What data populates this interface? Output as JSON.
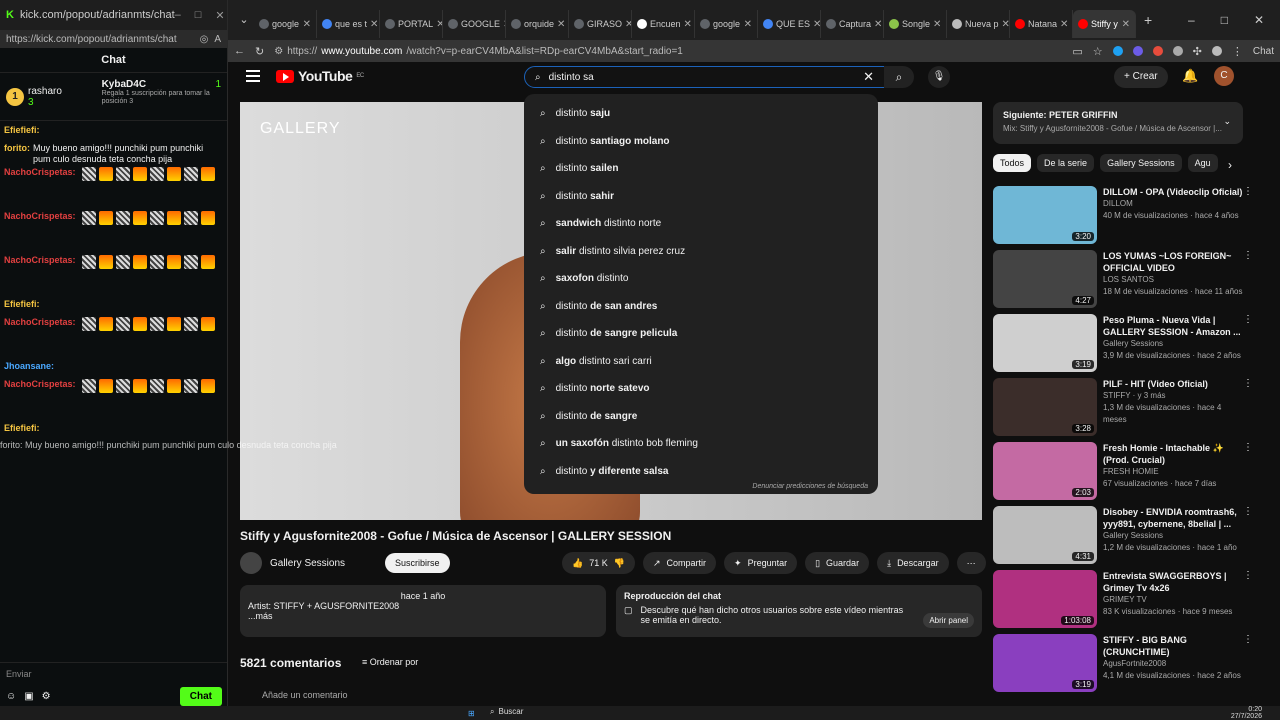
{
  "kick": {
    "window_title": "kick.com/popout/adrianmts/chat",
    "url": "https://kick.com/popout/adrianmts/chat",
    "chat_title": "Chat",
    "pinned": {
      "user1": "rasharo",
      "user1_level": "3",
      "user2": "KybaD4C",
      "user2_count": "1",
      "gift_text": "Regala 1 suscripción para tomar la posición 3"
    },
    "messages": [
      {
        "user": "Efiefiefi:",
        "text": "",
        "color": "yel"
      },
      {
        "user": "forito:",
        "text": "Muy bueno amigo!!! punchiki pum punchiki pum culo desnuda teta concha pija",
        "color": "yel"
      },
      {
        "user": "NachoCrispetas:",
        "text": "",
        "color": "red"
      },
      {
        "user": "NachoCrispetas:",
        "text": "",
        "color": "red"
      },
      {
        "user": "NachoCrispetas:",
        "text": "",
        "color": "red"
      },
      {
        "user": "Efiefiefi:",
        "text": "",
        "color": "yel"
      },
      {
        "user": "NachoCrispetas:",
        "text": "",
        "color": "red"
      },
      {
        "user": "Jhoansane:",
        "text": "",
        "color": "blue"
      },
      {
        "user": "NachoCrispetas:",
        "text": "",
        "color": "red"
      },
      {
        "user": "Efiefiefi:",
        "text": "",
        "color": "yel"
      }
    ],
    "overlay_text": "forito: Muy bueno amigo!!! punchiki pum punchiki pum culo desnuda teta concha pija",
    "send_label": "Enviar",
    "chat_button": "Chat"
  },
  "browser": {
    "tabs": [
      {
        "label": "google",
        "color": "#5f6368"
      },
      {
        "label": "que es t",
        "color": "#4285f4"
      },
      {
        "label": "PORTAL",
        "color": "#5f6368"
      },
      {
        "label": "GOOGLE",
        "color": "#5f6368"
      },
      {
        "label": "orquide",
        "color": "#5f6368"
      },
      {
        "label": "GIRASO",
        "color": "#5f6368"
      },
      {
        "label": "Encuen",
        "color": "#ffffff"
      },
      {
        "label": "google",
        "color": "#5f6368"
      },
      {
        "label": "QUE ES",
        "color": "#4285f4"
      },
      {
        "label": "Captura",
        "color": "#5f6368"
      },
      {
        "label": "Songle",
        "color": "#8bc34a"
      },
      {
        "label": "Nueva p",
        "color": "#bbbbbb"
      },
      {
        "label": "Natana",
        "color": "#ff0000"
      },
      {
        "label": "Stiffy y",
        "color": "#ff0000"
      }
    ],
    "url_prefix": "https://",
    "url_domain": "www.youtube.com",
    "url_path": "/watch?v=p-earCV4MbA&list=RDp-earCV4MbA&start_radio=1",
    "ext_label": "Chat"
  },
  "youtube": {
    "logo_text": "YouTube",
    "logo_sup": "EC",
    "search_value": "distinto sa",
    "create_label": "Crear",
    "avatar_letter": "C",
    "suggestions": [
      {
        "pre": "distinto ",
        "bold": "saju",
        "post": ""
      },
      {
        "pre": "distinto ",
        "bold": "santiago molano",
        "post": ""
      },
      {
        "pre": "distinto ",
        "bold": "sailen",
        "post": ""
      },
      {
        "pre": "distinto ",
        "bold": "sahir",
        "post": ""
      },
      {
        "pre": "",
        "bold": "sandwich ",
        "post": "distinto norte"
      },
      {
        "pre": "",
        "bold": "salir ",
        "post": "distinto silvia perez cruz"
      },
      {
        "pre": "",
        "bold": "saxofon ",
        "post": "distinto"
      },
      {
        "pre": "distinto ",
        "bold": "de san andres",
        "post": ""
      },
      {
        "pre": "distinto ",
        "bold": "de sangre pelicula",
        "post": ""
      },
      {
        "pre": "",
        "bold": "algo ",
        "post": "distinto sari carri"
      },
      {
        "pre": "distinto ",
        "bold": "norte satevo",
        "post": ""
      },
      {
        "pre": "distinto ",
        "bold": "de sangre",
        "post": ""
      },
      {
        "pre": "",
        "bold": "un saxofón ",
        "post": "distinto bob fleming"
      },
      {
        "pre": "distinto ",
        "bold": "y diferente salsa",
        "post": ""
      }
    ],
    "report_predictions": "Denunciar predicciones de búsqueda",
    "video_overlay": "GALLERY",
    "video_title": "Stiffy y Agusfornite2008 - Gofue / Música de Ascensor | GALLERY SESSION",
    "channel": "Gallery Sessions",
    "subscribe": "Suscribirse",
    "likes": "71 K",
    "share": "Compartir",
    "ask": "Preguntar",
    "save": "Guardar",
    "download": "Descargar",
    "desc_line1": "hace 1 año",
    "desc_line2": "Artist: STIFFY + AGUSFORNITE2008",
    "desc_more": "...más",
    "chat_replay_title": "Reproducción del chat",
    "chat_replay_text": "Descubre qué han dicho otros usuarios sobre este vídeo mientras se emitía en directo.",
    "chat_replay_btn": "Abrir panel",
    "comments_count": "5821 comentarios",
    "sort_by": "Ordenar por",
    "add_comment": "Añade un comentario",
    "next_label": "Siguiente: PETER GRIFFIN",
    "next_sub": "Mix: Stiffy y Agusfornite2008 - Gofue / Música de Ascensor |...",
    "chips": [
      "Todos",
      "De la serie",
      "Gallery Sessions",
      "Agu"
    ],
    "recommendations": [
      {
        "title": "DILLOM - OPA (Videoclip Oficial)",
        "channel": "DILLOM",
        "stats": "40 M de visualizaciones · hace 4 años",
        "duration": "3:20",
        "color": "#6fb7d6"
      },
      {
        "title": "LOS YUMAS ~LOS FOREIGN~ OFFICIAL VIDEO",
        "channel": "LOS SANTOS",
        "stats": "18 M de visualizaciones · hace 11 años",
        "duration": "4:27",
        "color": "#444444"
      },
      {
        "title": "Peso Pluma - Nueva Vida | GALLERY SESSION - Amazon ...",
        "channel": "Gallery Sessions",
        "stats": "3,9 M de visualizaciones · hace 2 años",
        "duration": "3:19",
        "color": "#cfcfcf"
      },
      {
        "title": "PILF - HIT (Video Oficial)",
        "channel": "STIFFY · y 3 más",
        "stats": "1,3 M de visualizaciones · hace 4 meses",
        "duration": "3:28",
        "color": "#3b2d2a"
      },
      {
        "title": "Fresh Homie - Intachable ✨ (Prod. Crucial)",
        "channel": "FRESH HOMIE",
        "stats": "67 visualizaciones · hace 7 días",
        "duration": "2:03",
        "color": "#c46aa3"
      },
      {
        "title": "Disobey - ENVIDIA roomtrash6, yyy891, cybernene, 8belial | ...",
        "channel": "Gallery Sessions",
        "stats": "1,2 M de visualizaciones · hace 1 año",
        "duration": "4:31",
        "color": "#bdbdbd"
      },
      {
        "title": "Entrevista SWAGGERBOYS | Grimey Tv 4x26",
        "channel": "GRIMEY TV",
        "stats": "83 K visualizaciones · hace 9 meses",
        "duration": "1:03:08",
        "color": "#b03080"
      },
      {
        "title": "STIFFY - BIG BANG (CRUNCHTIME)",
        "channel": "AgusFortnite2008",
        "stats": "4,1 M de visualizaciones · hace 2 años",
        "duration": "3:19",
        "color": "#8a3fbf"
      }
    ]
  },
  "taskbar": {
    "search_label": "Buscar",
    "time": "0:20",
    "date": "27/7/2026"
  }
}
